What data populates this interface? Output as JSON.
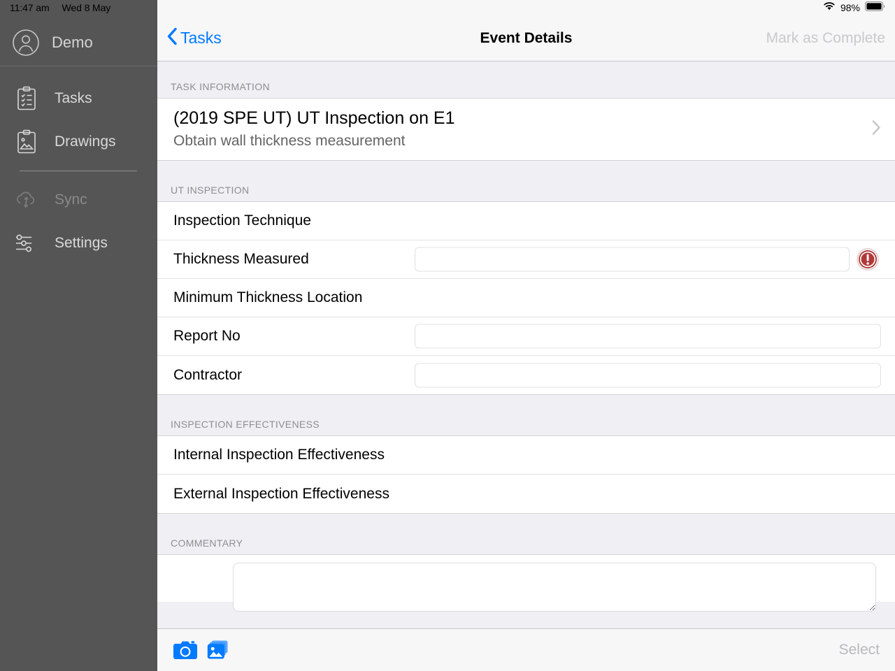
{
  "status_bar": {
    "time": "11:47 am",
    "date": "Wed 8 May",
    "wifi_icon": "wifi-icon",
    "battery_percent": "98%",
    "battery_icon": "battery-full-icon"
  },
  "sidebar": {
    "account": {
      "name": "Demo",
      "avatar_icon": "person-circle-icon"
    },
    "items": [
      {
        "label": "Tasks",
        "icon": "clipboard-checklist-icon",
        "enabled": true
      },
      {
        "label": "Drawings",
        "icon": "clipboard-image-icon",
        "enabled": true
      },
      {
        "label": "Sync",
        "icon": "cloud-sync-icon",
        "enabled": false
      },
      {
        "label": "Settings",
        "icon": "sliders-icon",
        "enabled": true
      }
    ]
  },
  "navbar": {
    "back_label": "Tasks",
    "back_icon": "chevron-left-icon",
    "title": "Event Details",
    "action_label": "Mark as Complete",
    "action_enabled": false
  },
  "sections": {
    "task_information": {
      "header": "TASK INFORMATION",
      "task_title": "(2019 SPE UT) UT Inspection on E1",
      "task_subtitle": "Obtain wall thickness measurement",
      "disclosure_icon": "chevron-right-icon"
    },
    "ut_inspection": {
      "header": "UT INSPECTION",
      "rows": [
        {
          "label": "Inspection Technique",
          "field": false,
          "value": "",
          "error": false
        },
        {
          "label": "Thickness Measured",
          "field": true,
          "value": "",
          "error": true,
          "error_icon": "exclamation-circle-icon"
        },
        {
          "label": "Minimum Thickness Location",
          "field": false,
          "value": "",
          "error": false
        },
        {
          "label": "Report No",
          "field": true,
          "value": "",
          "error": false
        },
        {
          "label": "Contractor",
          "field": true,
          "value": "",
          "error": false
        }
      ]
    },
    "inspection_effectiveness": {
      "header": "INSPECTION EFFECTIVENESS",
      "rows": [
        {
          "label": "Internal Inspection Effectiveness"
        },
        {
          "label": "External Inspection Effectiveness"
        }
      ]
    },
    "commentary": {
      "header": "COMMENTARY",
      "textarea_value": "",
      "textarea_placeholder": ""
    }
  },
  "toolbar": {
    "camera_icon": "camera-icon",
    "photo_library_icon": "photo-library-icon",
    "select_label": "Select",
    "select_enabled": false
  },
  "colors": {
    "accent_blue": "#007aff",
    "sidebar_bg": "#555555",
    "group_bg": "#efeff4",
    "error_red": "#b03a3a",
    "disabled_gray": "#c9c9cd"
  }
}
